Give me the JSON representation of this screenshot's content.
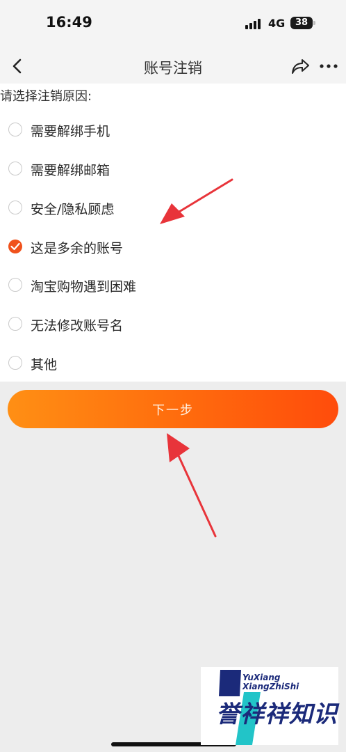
{
  "status_bar": {
    "time": "16:49",
    "network": "4G",
    "battery": "38"
  },
  "nav": {
    "back_icon": "chevron-left-icon",
    "title": "账号注销",
    "share_icon": "share-icon",
    "more_icon": "more-icon"
  },
  "reasons": {
    "title": "请选择注销原因:",
    "options": [
      {
        "label": "需要解绑手机",
        "checked": false
      },
      {
        "label": "需要解绑邮箱",
        "checked": false
      },
      {
        "label": "安全/隐私顾虑",
        "checked": false
      },
      {
        "label": "这是多余的账号",
        "checked": true
      },
      {
        "label": "淘宝购物遇到困难",
        "checked": false
      },
      {
        "label": "无法修改账号名",
        "checked": false
      },
      {
        "label": "其他",
        "checked": false
      }
    ]
  },
  "next_button": {
    "label": "下一步"
  },
  "watermark": {
    "line1": "YuXiang",
    "line2": "XiangZhiShi",
    "cn": "誉祥祥知识"
  },
  "colors": {
    "accent": "#f0521c",
    "button_start": "#ff8f14",
    "button_end": "#ff4c0c",
    "annotation_arrow": "#e8343a"
  }
}
